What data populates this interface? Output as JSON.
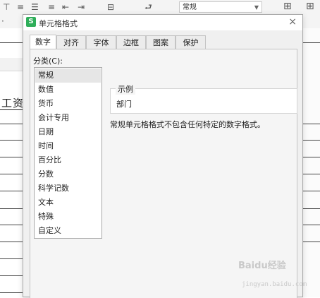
{
  "ribbon": {
    "number_format_value": "常规",
    "icons": [
      "align-top-icon",
      "align-middle-icon",
      "align-bottom-icon",
      "indent-decrease-icon",
      "indent-increase-icon",
      "merge-cells-icon",
      "wrap-text-icon",
      "table-style-icon"
    ]
  },
  "sheet": {
    "cell_text": "工资"
  },
  "dialog": {
    "title": "单元格格式",
    "app_icon_letter": "S",
    "close_label": "×",
    "tabs": [
      {
        "label": "数字",
        "active": true
      },
      {
        "label": "对齐"
      },
      {
        "label": "字体"
      },
      {
        "label": "边框"
      },
      {
        "label": "图案"
      },
      {
        "label": "保护"
      }
    ],
    "category_label": "分类(C):",
    "categories": [
      {
        "label": "常规",
        "selected": true
      },
      {
        "label": "数值"
      },
      {
        "label": "货币"
      },
      {
        "label": "会计专用"
      },
      {
        "label": "日期"
      },
      {
        "label": "时间"
      },
      {
        "label": "百分比"
      },
      {
        "label": "分数"
      },
      {
        "label": "科学记数"
      },
      {
        "label": "文本"
      },
      {
        "label": "特殊"
      },
      {
        "label": "自定义"
      }
    ],
    "sample_label": "示例",
    "sample_value": "部门",
    "description": "常规单元格格式不包含任何特定的数字格式。"
  },
  "watermark": {
    "text": "Baidu经验",
    "sub": "jingyan.baidu.com"
  },
  "colors": {
    "app_icon": "#2fae5a",
    "selected_item": "#e6e6e6",
    "dialog_bg": "#f0f0f0"
  }
}
